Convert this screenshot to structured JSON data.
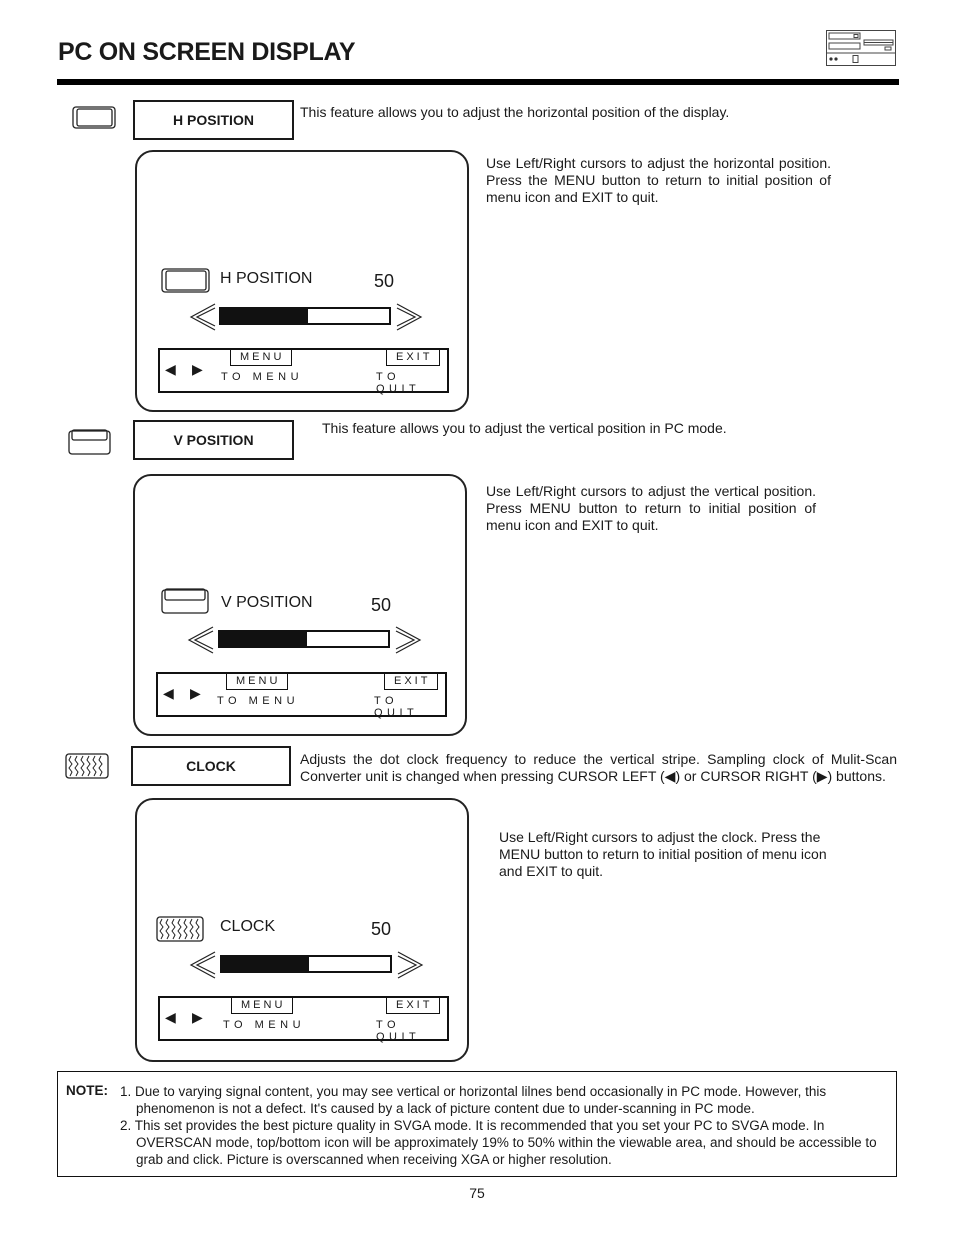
{
  "page": {
    "title": "PC ON SCREEN DISPLAY",
    "page_number": "75",
    "header_icon": "pc-device-icon"
  },
  "sections": [
    {
      "id": "h-position",
      "icon": "h-position-icon",
      "label": "H POSITION",
      "description": "This feature allows you to adjust the horizontal position of the display.",
      "instructions": "Use Left/Right cursors to adjust the horizontal position. Press the MENU button to return to initial position of menu icon and EXIT to quit.",
      "osd": {
        "label": "H POSITION",
        "value": "50",
        "level_percent": 50,
        "menu_button": "MENU",
        "menu_hint": "TO MENU",
        "exit_button": "EXIT",
        "exit_hint": "TO QUIT",
        "nav_left": "◀",
        "nav_right": "▶"
      }
    },
    {
      "id": "v-position",
      "icon": "v-position-icon",
      "label": "V POSITION",
      "description": "This feature allows you to adjust the vertical position in PC mode.",
      "instructions": "Use Left/Right cursors to adjust the vertical position. Press MENU button to return to initial position of menu icon and EXIT to quit.",
      "osd": {
        "label": "V POSITION",
        "value": "50",
        "level_percent": 50,
        "menu_button": "MENU",
        "menu_hint": "TO MENU",
        "exit_button": "EXIT",
        "exit_hint": "TO QUIT",
        "nav_left": "◀",
        "nav_right": "▶"
      }
    },
    {
      "id": "clock",
      "icon": "clock-icon",
      "label": "CLOCK",
      "description": "Adjusts the dot clock frequency to reduce the vertical stripe.  Sampling clock of Mulit-Scan Converter unit is changed when pressing CURSOR LEFT (◀)  or CURSOR RIGHT (▶) buttons.",
      "instructions": "Use Left/Right cursors to adjust the clock.  Press the MENU button to return to initial position of menu icon and EXIT to quit.",
      "osd": {
        "label": "CLOCK",
        "value": "50",
        "level_percent": 50,
        "menu_button": "MENU",
        "menu_hint": "TO MENU",
        "exit_button": "EXIT",
        "exit_hint": "TO QUIT",
        "nav_left": "◀",
        "nav_right": "▶"
      }
    }
  ],
  "note": {
    "label": "NOTE:",
    "items": [
      "1. Due to varying signal content, you may see vertical or horizontal lilnes bend occasionally in PC mode.  However, this phenomenon is not a defect.  It's caused by a lack of picture content due to under-scanning in PC mode.",
      "2. This set provides the best picture quality in SVGA mode.  It is recommended that you set your PC to SVGA mode.  In OVERSCAN mode, top/bottom icon will be approximately 19% to 50% within the viewable area, and should be accessible to grab and click.  Picture is overscanned when receiving XGA or higher resolution."
    ]
  }
}
